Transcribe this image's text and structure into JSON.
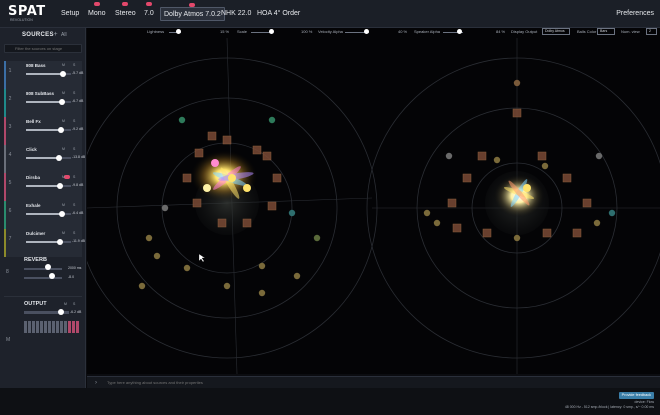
{
  "app": {
    "logo": "SPAT",
    "logo_sub": "REVOLUTION"
  },
  "colors": {
    "accent_red": "#e2486b",
    "accent_blue": "#3a7ea8",
    "panel": "#1e222b",
    "viewport": "#040406"
  },
  "tabs": [
    {
      "label": "Setup",
      "badge": false,
      "active": false
    },
    {
      "label": "Mono",
      "badge": true,
      "active": false
    },
    {
      "label": "Stereo",
      "badge": true,
      "active": false
    },
    {
      "label": "7.0",
      "badge": true,
      "active": false
    },
    {
      "label": "Dolby Atmos 7.0.2",
      "badge": true,
      "active": true
    },
    {
      "label": "NHK 22.0",
      "badge": false,
      "active": false
    },
    {
      "label": "HOA 4° Order",
      "badge": false,
      "active": false
    }
  ],
  "preferences_label": "Preferences",
  "sidebar": {
    "title": "SOURCES",
    "all_label": "All",
    "add_icon": "plus-icon",
    "search_placeholder": "Filter the sources on stage",
    "sources": [
      {
        "num": "1",
        "name": "808 Bass",
        "m": "M",
        "s": "S",
        "gain": "-5.7 dB",
        "level": 0.82,
        "color": "#3b6ea5",
        "rec": false
      },
      {
        "num": "2",
        "name": "808 SubBass",
        "m": "M",
        "s": "S",
        "gain": "-6.7 dB",
        "level": 0.8,
        "color": "#1f8a8a",
        "rec": false
      },
      {
        "num": "3",
        "name": "Bell Fx",
        "m": "M",
        "s": "S",
        "gain": "-9.2 dB",
        "level": 0.78,
        "color": "#b0486a",
        "rec": false
      },
      {
        "num": "4",
        "name": "Click",
        "m": "M",
        "s": "S",
        "gain": "-13.8 dB",
        "level": 0.74,
        "color": "#6a6f7a",
        "rec": false
      },
      {
        "num": "5",
        "name": "Dirsba",
        "m": "M",
        "s": "S",
        "gain": "-9.8 dB",
        "level": 0.76,
        "color": "#b0486a",
        "rec": true
      },
      {
        "num": "6",
        "name": "Exhale",
        "m": "M",
        "s": "S",
        "gain": "-6.4 dB",
        "level": 0.8,
        "color": "#2a8c6e",
        "rec": false
      },
      {
        "num": "7",
        "name": "Dulcimer",
        "m": "M",
        "s": "S",
        "gain": "-11.9 dB",
        "level": 0.75,
        "color": "#8c8a2a",
        "rec": false
      }
    ]
  },
  "reverb": {
    "num": "8",
    "title": "REVERB",
    "room_value": "2000 ms",
    "level_value": "-8.0",
    "room_level": 0.62,
    "level_level": 0.74
  },
  "output": {
    "num": "M",
    "title": "OUTPUT",
    "m": "M",
    "s": "S",
    "gain": "-6.2 dB",
    "level": 0.82
  },
  "controls": {
    "lightness_label": "Lightness",
    "lightness_value": "15 %",
    "scale_label": "Scale",
    "scale_value": "100 %",
    "velocity_label": "Velocity Alpha",
    "velocity_value": "40 %",
    "speaker_label": "Speaker Alpha",
    "speaker_value": "84 %",
    "display_output_label": "Display Output",
    "display_output_value": "Dolby Atmos",
    "ball_color_label": "Balls Color",
    "ball_color_value": "Bars",
    "num_view_label": "Num. view",
    "num_view_value": "2"
  },
  "bottom_input_placeholder": "Type here anything about sources and their properties",
  "status": {
    "feedback_label": "Provide feedback",
    "line1": "device: Flow",
    "line2": "48 000 Hz - 512 smp./block | latency: 0 smp., s/~ 0.00 ms"
  }
}
